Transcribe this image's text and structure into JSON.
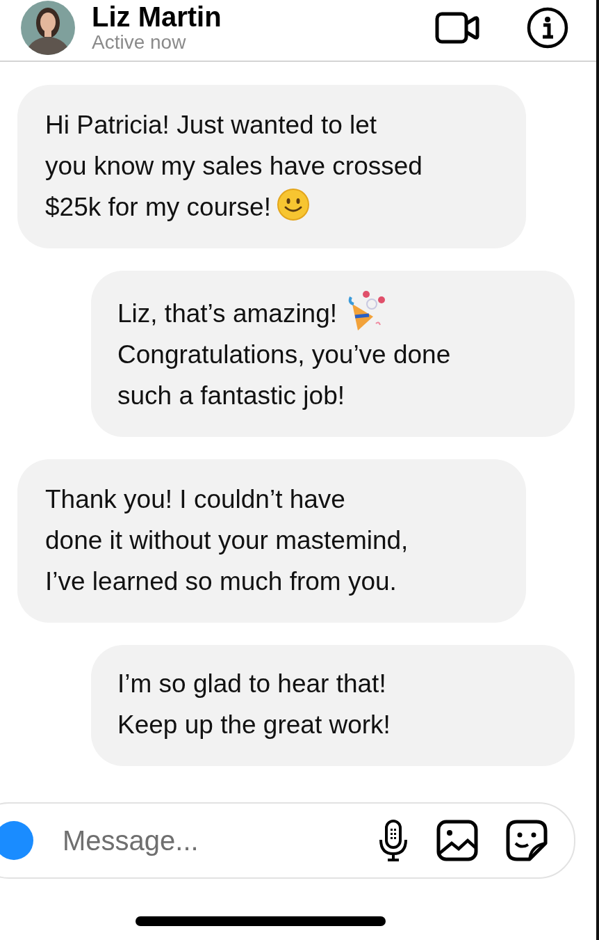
{
  "header": {
    "contact_name": "Liz Martin",
    "status": "Active now"
  },
  "messages": [
    {
      "kind": "incoming",
      "content": [
        {
          "kind": "text",
          "text": "Hi Patricia! Just wanted to let\nyou know my sales have crossed\n$25k for my course!"
        },
        {
          "kind": "smiley"
        }
      ]
    },
    {
      "kind": "outgoing",
      "content": [
        {
          "kind": "text",
          "text": "Liz, that’s amazing!"
        },
        {
          "kind": "party"
        },
        {
          "kind": "text",
          "text": "\nCongratulations, you’ve done\nsuch a fantastic job!"
        }
      ]
    },
    {
      "kind": "incoming",
      "content": [
        {
          "kind": "text",
          "text": "Thank you! I couldn’t have\ndone it without your mastemind,\nI’ve learned so much from you."
        }
      ]
    },
    {
      "kind": "outgoing",
      "content": [
        {
          "kind": "text",
          "text": "I’m so glad to hear that!\nKeep up the great work!"
        }
      ]
    }
  ],
  "composer": {
    "placeholder": "Message..."
  }
}
